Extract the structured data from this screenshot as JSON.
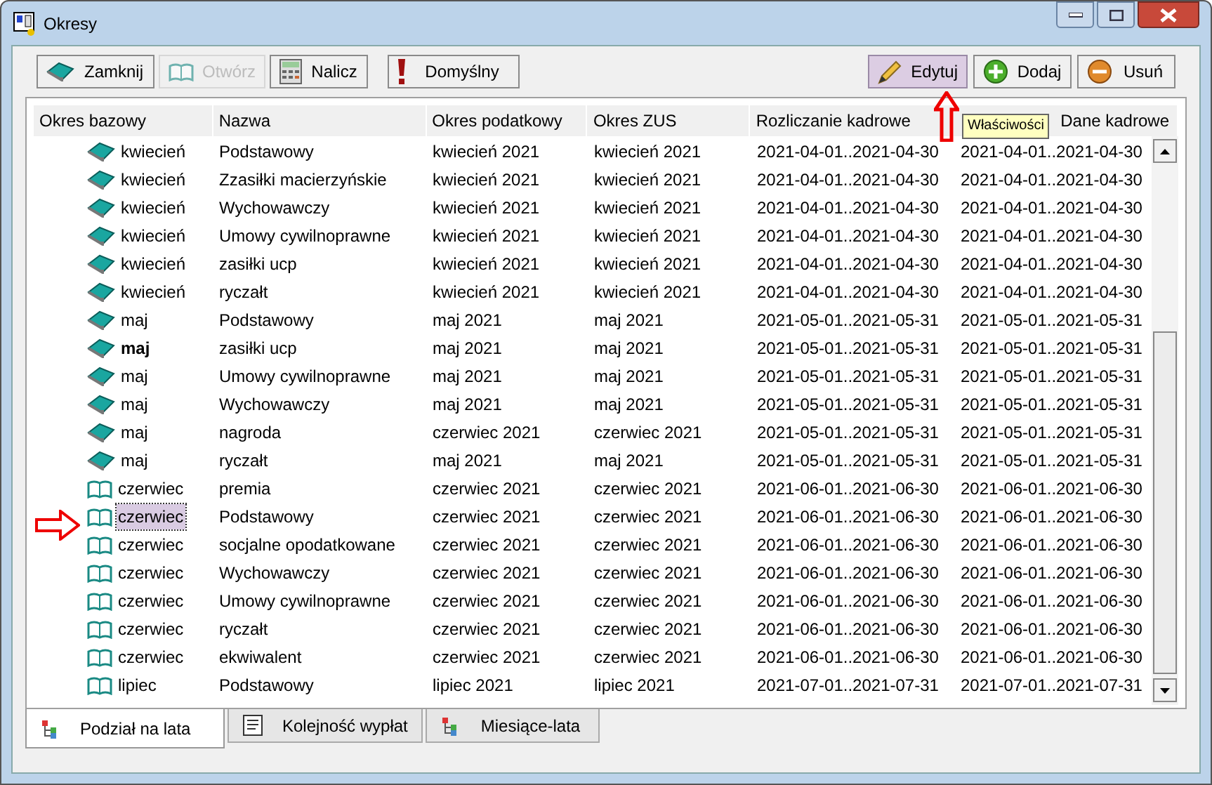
{
  "window": {
    "title": "Okresy"
  },
  "toolbar": [
    {
      "kind": "closed-book",
      "label": "Zamknij",
      "disabled": false,
      "highlighted": false
    },
    {
      "kind": "open-book",
      "label": "Otwórz",
      "disabled": true,
      "highlighted": false
    },
    {
      "kind": "calculator",
      "label": "Nalicz",
      "disabled": false,
      "highlighted": false
    },
    {
      "kind": "exclamation",
      "label": "Domyślny",
      "disabled": false,
      "highlighted": false
    },
    {
      "kind": "pencil",
      "label": "Edytuj",
      "disabled": false,
      "highlighted": true
    },
    {
      "kind": "plus",
      "label": "Dodaj",
      "disabled": false,
      "highlighted": false
    },
    {
      "kind": "minus",
      "label": "Usuń",
      "disabled": false,
      "highlighted": false
    }
  ],
  "tooltip": "Właściwości",
  "table": {
    "columns": [
      "Okres bazowy",
      "Nazwa",
      "Okres podatkowy",
      "Okres ZUS",
      "Rozliczanie kadrowe",
      "Dane kadrowe"
    ],
    "rows": [
      {
        "open": false,
        "bold": false,
        "selected": false,
        "cells": [
          "kwiecień",
          "Podstawowy",
          "kwiecień 2021",
          "kwiecień 2021",
          "2021-04-01..2021-04-30",
          "2021-04-01..2021-04-30"
        ]
      },
      {
        "open": false,
        "bold": false,
        "selected": false,
        "cells": [
          "kwiecień",
          "Zzasiłki macierzyńskie",
          "kwiecień 2021",
          "kwiecień 2021",
          "2021-04-01..2021-04-30",
          "2021-04-01..2021-04-30"
        ]
      },
      {
        "open": false,
        "bold": false,
        "selected": false,
        "cells": [
          "kwiecień",
          "Wychowawczy",
          "kwiecień 2021",
          "kwiecień 2021",
          "2021-04-01..2021-04-30",
          "2021-04-01..2021-04-30"
        ]
      },
      {
        "open": false,
        "bold": false,
        "selected": false,
        "cells": [
          "kwiecień",
          "Umowy cywilnoprawne",
          "kwiecień 2021",
          "kwiecień 2021",
          "2021-04-01..2021-04-30",
          "2021-04-01..2021-04-30"
        ]
      },
      {
        "open": false,
        "bold": false,
        "selected": false,
        "cells": [
          "kwiecień",
          "zasiłki ucp",
          "kwiecień 2021",
          "kwiecień 2021",
          "2021-04-01..2021-04-30",
          "2021-04-01..2021-04-30"
        ]
      },
      {
        "open": false,
        "bold": false,
        "selected": false,
        "cells": [
          "kwiecień",
          "ryczałt",
          "kwiecień 2021",
          "kwiecień 2021",
          "2021-04-01..2021-04-30",
          "2021-04-01..2021-04-30"
        ]
      },
      {
        "open": false,
        "bold": false,
        "selected": false,
        "cells": [
          "maj",
          "Podstawowy",
          "maj 2021",
          "maj 2021",
          "2021-05-01..2021-05-31",
          "2021-05-01..2021-05-31"
        ]
      },
      {
        "open": false,
        "bold": true,
        "selected": false,
        "cells": [
          "maj",
          "zasiłki ucp",
          "maj 2021",
          "maj 2021",
          "2021-05-01..2021-05-31",
          "2021-05-01..2021-05-31"
        ]
      },
      {
        "open": false,
        "bold": false,
        "selected": false,
        "cells": [
          "maj",
          "Umowy cywilnoprawne",
          "maj 2021",
          "maj 2021",
          "2021-05-01..2021-05-31",
          "2021-05-01..2021-05-31"
        ]
      },
      {
        "open": false,
        "bold": false,
        "selected": false,
        "cells": [
          "maj",
          "Wychowawczy",
          "maj 2021",
          "maj 2021",
          "2021-05-01..2021-05-31",
          "2021-05-01..2021-05-31"
        ]
      },
      {
        "open": false,
        "bold": false,
        "selected": false,
        "cells": [
          "maj",
          "nagroda",
          "czerwiec 2021",
          "czerwiec 2021",
          "2021-05-01..2021-05-31",
          "2021-05-01..2021-05-31"
        ]
      },
      {
        "open": false,
        "bold": false,
        "selected": false,
        "cells": [
          "maj",
          "ryczałt",
          "maj 2021",
          "maj 2021",
          "2021-05-01..2021-05-31",
          "2021-05-01..2021-05-31"
        ]
      },
      {
        "open": true,
        "bold": false,
        "selected": false,
        "cells": [
          "czerwiec",
          "premia",
          "czerwiec 2021",
          "czerwiec 2021",
          "2021-06-01..2021-06-30",
          "2021-06-01..2021-06-30"
        ]
      },
      {
        "open": true,
        "bold": false,
        "selected": true,
        "cells": [
          "czerwiec",
          "Podstawowy",
          "czerwiec 2021",
          "czerwiec 2021",
          "2021-06-01..2021-06-30",
          "2021-06-01..2021-06-30"
        ]
      },
      {
        "open": true,
        "bold": false,
        "selected": false,
        "cells": [
          "czerwiec",
          "socjalne opodatkowane",
          "czerwiec 2021",
          "czerwiec 2021",
          "2021-06-01..2021-06-30",
          "2021-06-01..2021-06-30"
        ]
      },
      {
        "open": true,
        "bold": false,
        "selected": false,
        "cells": [
          "czerwiec",
          "Wychowawczy",
          "czerwiec 2021",
          "czerwiec 2021",
          "2021-06-01..2021-06-30",
          "2021-06-01..2021-06-30"
        ]
      },
      {
        "open": true,
        "bold": false,
        "selected": false,
        "cells": [
          "czerwiec",
          "Umowy cywilnoprawne",
          "czerwiec 2021",
          "czerwiec 2021",
          "2021-06-01..2021-06-30",
          "2021-06-01..2021-06-30"
        ]
      },
      {
        "open": true,
        "bold": false,
        "selected": false,
        "cells": [
          "czerwiec",
          "ryczałt",
          "czerwiec 2021",
          "czerwiec 2021",
          "2021-06-01..2021-06-30",
          "2021-06-01..2021-06-30"
        ]
      },
      {
        "open": true,
        "bold": false,
        "selected": false,
        "cells": [
          "czerwiec",
          "ekwiwalent",
          "czerwiec 2021",
          "czerwiec 2021",
          "2021-06-01..2021-06-30",
          "2021-06-01..2021-06-30"
        ]
      },
      {
        "open": true,
        "bold": false,
        "selected": false,
        "cells": [
          "lipiec",
          "Podstawowy",
          "lipiec 2021",
          "lipiec 2021",
          "2021-07-01..2021-07-31",
          "2021-07-01..2021-07-31"
        ]
      }
    ]
  },
  "tabs": [
    {
      "kind": "tree",
      "label": "Podział na lata",
      "selected": true
    },
    {
      "kind": "list",
      "label": "Kolejność wypłat",
      "selected": false
    },
    {
      "kind": "tree",
      "label": "Miesiące-lata",
      "selected": false
    }
  ]
}
